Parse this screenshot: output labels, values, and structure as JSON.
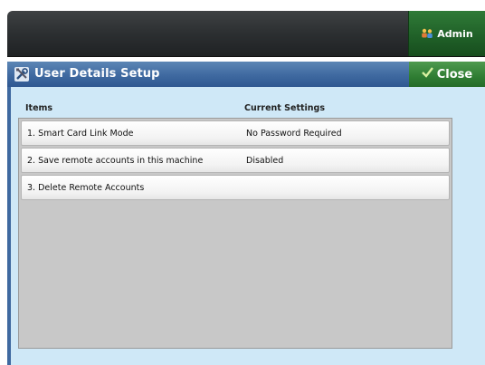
{
  "header": {
    "admin_label": "Admin"
  },
  "dialog": {
    "title": "User Details Setup",
    "close_label": "Close"
  },
  "table": {
    "columns": {
      "items": "Items",
      "settings": "Current Settings"
    },
    "rows": [
      {
        "label": "1. Smart Card Link Mode",
        "setting": "No Password Required"
      },
      {
        "label": "2. Save remote accounts in this machine",
        "setting": "Disabled"
      },
      {
        "label": "3. Delete Remote Accounts",
        "setting": ""
      }
    ]
  },
  "colors": {
    "title_bar": "#3f69a0",
    "close_button": "#2f7d33",
    "admin_button": "#1f5f27",
    "panel_bg": "#cfe8f7"
  },
  "icons": {
    "admin": "users-icon",
    "title": "tools-icon",
    "close": "checkmark-icon"
  }
}
